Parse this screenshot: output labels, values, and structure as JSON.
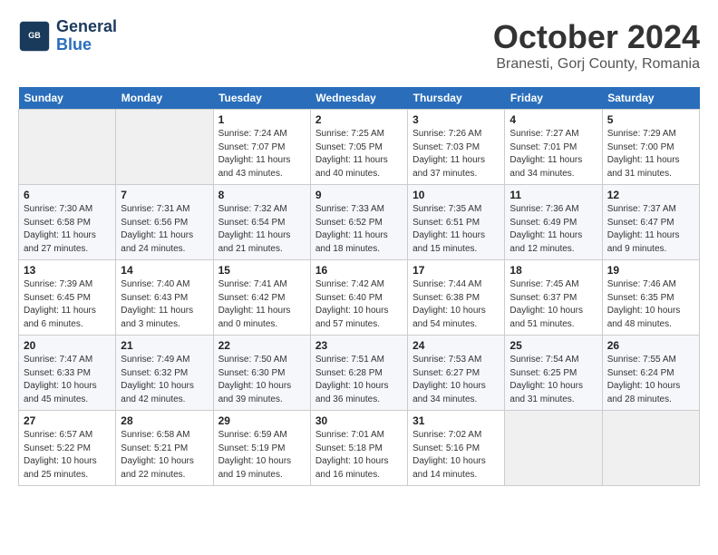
{
  "header": {
    "logo_line1": "General",
    "logo_line2": "Blue",
    "month": "October 2024",
    "location": "Branesti, Gorj County, Romania"
  },
  "weekdays": [
    "Sunday",
    "Monday",
    "Tuesday",
    "Wednesday",
    "Thursday",
    "Friday",
    "Saturday"
  ],
  "weeks": [
    [
      {
        "day": "",
        "info": ""
      },
      {
        "day": "",
        "info": ""
      },
      {
        "day": "1",
        "info": "Sunrise: 7:24 AM\nSunset: 7:07 PM\nDaylight: 11 hours and 43 minutes."
      },
      {
        "day": "2",
        "info": "Sunrise: 7:25 AM\nSunset: 7:05 PM\nDaylight: 11 hours and 40 minutes."
      },
      {
        "day": "3",
        "info": "Sunrise: 7:26 AM\nSunset: 7:03 PM\nDaylight: 11 hours and 37 minutes."
      },
      {
        "day": "4",
        "info": "Sunrise: 7:27 AM\nSunset: 7:01 PM\nDaylight: 11 hours and 34 minutes."
      },
      {
        "day": "5",
        "info": "Sunrise: 7:29 AM\nSunset: 7:00 PM\nDaylight: 11 hours and 31 minutes."
      }
    ],
    [
      {
        "day": "6",
        "info": "Sunrise: 7:30 AM\nSunset: 6:58 PM\nDaylight: 11 hours and 27 minutes."
      },
      {
        "day": "7",
        "info": "Sunrise: 7:31 AM\nSunset: 6:56 PM\nDaylight: 11 hours and 24 minutes."
      },
      {
        "day": "8",
        "info": "Sunrise: 7:32 AM\nSunset: 6:54 PM\nDaylight: 11 hours and 21 minutes."
      },
      {
        "day": "9",
        "info": "Sunrise: 7:33 AM\nSunset: 6:52 PM\nDaylight: 11 hours and 18 minutes."
      },
      {
        "day": "10",
        "info": "Sunrise: 7:35 AM\nSunset: 6:51 PM\nDaylight: 11 hours and 15 minutes."
      },
      {
        "day": "11",
        "info": "Sunrise: 7:36 AM\nSunset: 6:49 PM\nDaylight: 11 hours and 12 minutes."
      },
      {
        "day": "12",
        "info": "Sunrise: 7:37 AM\nSunset: 6:47 PM\nDaylight: 11 hours and 9 minutes."
      }
    ],
    [
      {
        "day": "13",
        "info": "Sunrise: 7:39 AM\nSunset: 6:45 PM\nDaylight: 11 hours and 6 minutes."
      },
      {
        "day": "14",
        "info": "Sunrise: 7:40 AM\nSunset: 6:43 PM\nDaylight: 11 hours and 3 minutes."
      },
      {
        "day": "15",
        "info": "Sunrise: 7:41 AM\nSunset: 6:42 PM\nDaylight: 11 hours and 0 minutes."
      },
      {
        "day": "16",
        "info": "Sunrise: 7:42 AM\nSunset: 6:40 PM\nDaylight: 10 hours and 57 minutes."
      },
      {
        "day": "17",
        "info": "Sunrise: 7:44 AM\nSunset: 6:38 PM\nDaylight: 10 hours and 54 minutes."
      },
      {
        "day": "18",
        "info": "Sunrise: 7:45 AM\nSunset: 6:37 PM\nDaylight: 10 hours and 51 minutes."
      },
      {
        "day": "19",
        "info": "Sunrise: 7:46 AM\nSunset: 6:35 PM\nDaylight: 10 hours and 48 minutes."
      }
    ],
    [
      {
        "day": "20",
        "info": "Sunrise: 7:47 AM\nSunset: 6:33 PM\nDaylight: 10 hours and 45 minutes."
      },
      {
        "day": "21",
        "info": "Sunrise: 7:49 AM\nSunset: 6:32 PM\nDaylight: 10 hours and 42 minutes."
      },
      {
        "day": "22",
        "info": "Sunrise: 7:50 AM\nSunset: 6:30 PM\nDaylight: 10 hours and 39 minutes."
      },
      {
        "day": "23",
        "info": "Sunrise: 7:51 AM\nSunset: 6:28 PM\nDaylight: 10 hours and 36 minutes."
      },
      {
        "day": "24",
        "info": "Sunrise: 7:53 AM\nSunset: 6:27 PM\nDaylight: 10 hours and 34 minutes."
      },
      {
        "day": "25",
        "info": "Sunrise: 7:54 AM\nSunset: 6:25 PM\nDaylight: 10 hours and 31 minutes."
      },
      {
        "day": "26",
        "info": "Sunrise: 7:55 AM\nSunset: 6:24 PM\nDaylight: 10 hours and 28 minutes."
      }
    ],
    [
      {
        "day": "27",
        "info": "Sunrise: 6:57 AM\nSunset: 5:22 PM\nDaylight: 10 hours and 25 minutes."
      },
      {
        "day": "28",
        "info": "Sunrise: 6:58 AM\nSunset: 5:21 PM\nDaylight: 10 hours and 22 minutes."
      },
      {
        "day": "29",
        "info": "Sunrise: 6:59 AM\nSunset: 5:19 PM\nDaylight: 10 hours and 19 minutes."
      },
      {
        "day": "30",
        "info": "Sunrise: 7:01 AM\nSunset: 5:18 PM\nDaylight: 10 hours and 16 minutes."
      },
      {
        "day": "31",
        "info": "Sunrise: 7:02 AM\nSunset: 5:16 PM\nDaylight: 10 hours and 14 minutes."
      },
      {
        "day": "",
        "info": ""
      },
      {
        "day": "",
        "info": ""
      }
    ]
  ]
}
